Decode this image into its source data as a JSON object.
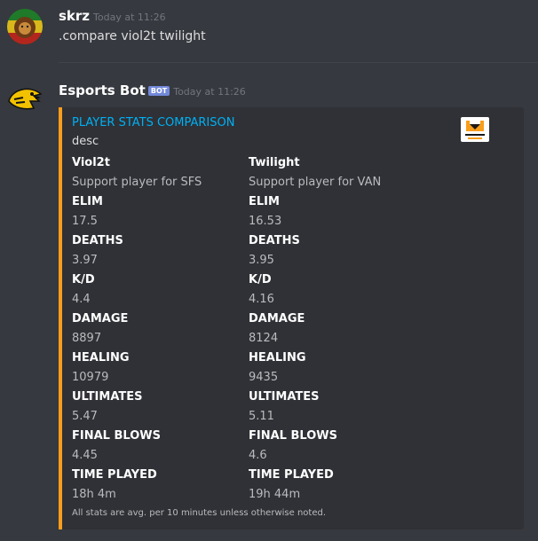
{
  "message1": {
    "author": "skrz",
    "timestamp": "Today at 11:26",
    "text": ".compare viol2t twilight"
  },
  "message2": {
    "author": "Esports Bot",
    "bot_tag": "BOT",
    "timestamp": "Today at 11:26",
    "embed": {
      "accent_color": "#f99e1a",
      "title": "PLAYER STATS COMPARISON",
      "description": "desc",
      "thumbnail": "overwatch-league-logo",
      "fields_left": [
        {
          "name": "Viol2t",
          "value": "Support player for SFS"
        },
        {
          "name": "ELIM",
          "value": "17.5"
        },
        {
          "name": "DEATHS",
          "value": "3.97"
        },
        {
          "name": "K/D",
          "value": "4.4"
        },
        {
          "name": "DAMAGE",
          "value": "8897"
        },
        {
          "name": "HEALING",
          "value": "10979"
        },
        {
          "name": "ULTIMATES",
          "value": "5.47"
        },
        {
          "name": "FINAL BLOWS",
          "value": "4.45"
        },
        {
          "name": "TIME PLAYED",
          "value": "18h 4m"
        }
      ],
      "fields_right": [
        {
          "name": "Twilight",
          "value": "Support player for VAN"
        },
        {
          "name": "ELIM",
          "value": "16.53"
        },
        {
          "name": "DEATHS",
          "value": "3.95"
        },
        {
          "name": "K/D",
          "value": "4.16"
        },
        {
          "name": "DAMAGE",
          "value": "8124"
        },
        {
          "name": "HEALING",
          "value": "9435"
        },
        {
          "name": "ULTIMATES",
          "value": "5.11"
        },
        {
          "name": "FINAL BLOWS",
          "value": "4.6"
        },
        {
          "name": "TIME PLAYED",
          "value": "19h 44m"
        }
      ],
      "footer": "All stats are avg. per 10 minutes unless otherwise noted."
    }
  }
}
